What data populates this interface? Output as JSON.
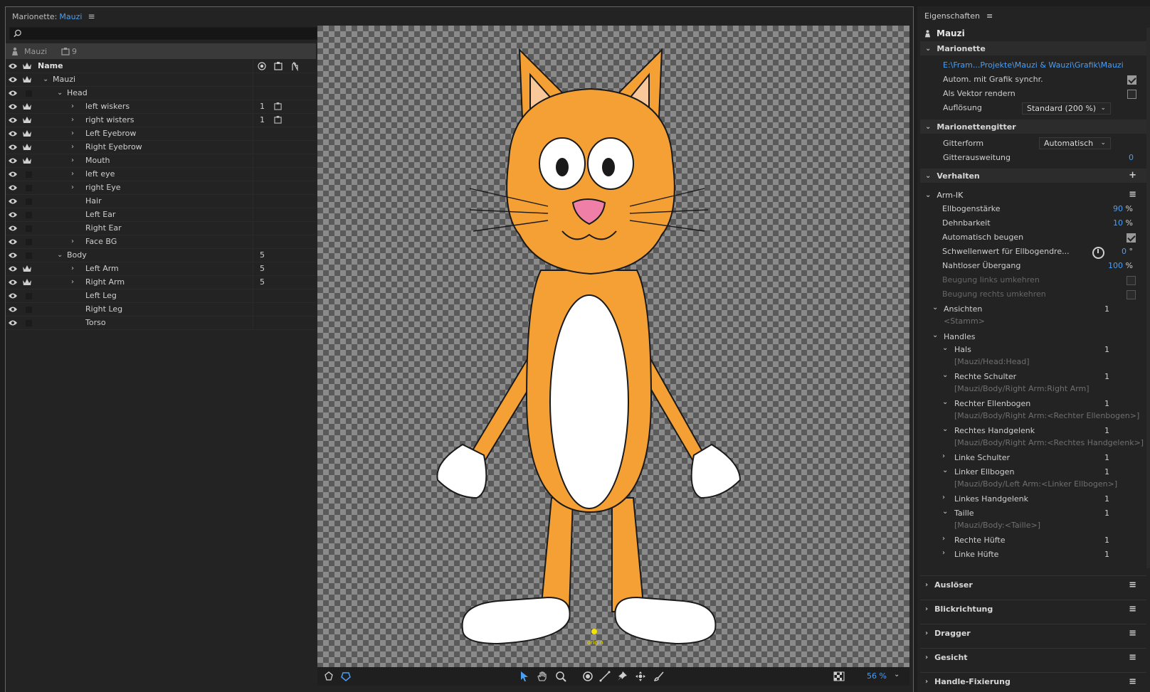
{
  "header": {
    "prefix": "Marionette:",
    "puppet_name": "Mauzi"
  },
  "puppet_bar": {
    "name": "Mauzi",
    "count": "9"
  },
  "layer_header": {
    "name": "Name"
  },
  "layers": [
    {
      "name": "Mauzi",
      "indent": 0,
      "expanded": true,
      "crown": true,
      "num": "",
      "icon": false,
      "has_chev": true
    },
    {
      "name": "Head",
      "indent": 1,
      "expanded": true,
      "crown": false,
      "num": "",
      "icon": false,
      "has_chev": true
    },
    {
      "name": "left wiskers",
      "indent": 2,
      "expanded": false,
      "crown": true,
      "num": "1",
      "icon": true,
      "has_chev": true
    },
    {
      "name": "right wisters",
      "indent": 2,
      "expanded": false,
      "crown": true,
      "num": "1",
      "icon": true,
      "has_chev": true
    },
    {
      "name": "Left Eyebrow",
      "indent": 2,
      "expanded": false,
      "crown": true,
      "num": "",
      "icon": false,
      "has_chev": true
    },
    {
      "name": "Right Eyebrow",
      "indent": 2,
      "expanded": false,
      "crown": true,
      "num": "",
      "icon": false,
      "has_chev": true
    },
    {
      "name": "Mouth",
      "indent": 2,
      "expanded": false,
      "crown": true,
      "num": "",
      "icon": false,
      "has_chev": true
    },
    {
      "name": "left eye",
      "indent": 2,
      "expanded": false,
      "crown": false,
      "num": "",
      "icon": false,
      "has_chev": true
    },
    {
      "name": "right Eye",
      "indent": 2,
      "expanded": false,
      "crown": false,
      "num": "",
      "icon": false,
      "has_chev": true
    },
    {
      "name": "Hair",
      "indent": 2,
      "expanded": false,
      "crown": false,
      "num": "",
      "icon": false,
      "has_chev": false
    },
    {
      "name": "Left Ear",
      "indent": 2,
      "expanded": false,
      "crown": false,
      "num": "",
      "icon": false,
      "has_chev": false
    },
    {
      "name": "Right Ear",
      "indent": 2,
      "expanded": false,
      "crown": false,
      "num": "",
      "icon": false,
      "has_chev": false
    },
    {
      "name": "Face BG",
      "indent": 2,
      "expanded": false,
      "crown": false,
      "num": "",
      "icon": false,
      "has_chev": true
    },
    {
      "name": "Body",
      "indent": 1,
      "expanded": true,
      "crown": false,
      "num": "5",
      "icon": false,
      "has_chev": true
    },
    {
      "name": "Left Arm",
      "indent": 2,
      "expanded": false,
      "crown": true,
      "num": "5",
      "icon": false,
      "has_chev": true
    },
    {
      "name": "Right Arm",
      "indent": 2,
      "expanded": false,
      "crown": true,
      "num": "5",
      "icon": false,
      "has_chev": true
    },
    {
      "name": "Left Leg",
      "indent": 2,
      "expanded": false,
      "crown": false,
      "num": "",
      "icon": false,
      "has_chev": false
    },
    {
      "name": "Right Leg",
      "indent": 2,
      "expanded": false,
      "crown": false,
      "num": "",
      "icon": false,
      "has_chev": false
    },
    {
      "name": "Torso",
      "indent": 2,
      "expanded": false,
      "crown": false,
      "num": "",
      "icon": false,
      "has_chev": false
    }
  ],
  "canvas": {
    "origin_label": "origin",
    "zoom": "56 %"
  },
  "properties": {
    "title": "Eigenschaften",
    "puppet": "Mauzi",
    "marionette": {
      "label": "Marionette",
      "path": "E:\\Fram...Projekte\\Mauzi & Wauzi\\Grafik\\Mauzi",
      "sync_label": "Autom. mit Grafik synchr.",
      "vector_label": "Als Vektor rendern",
      "resolution_label": "Auflösung",
      "resolution_value": "Standard (200 %)"
    },
    "mesh": {
      "label": "Marionettengitter",
      "form_label": "Gitterform",
      "form_value": "Automatisch",
      "expand_label": "Gitterausweitung",
      "expand_value": "0"
    },
    "behaviors": {
      "label": "Verhalten",
      "armik": "Arm-IK",
      "elbow_label": "Ellbogenstärke",
      "elbow_value": "90",
      "stretch_label": "Dehnbarkeit",
      "stretch_value": "10",
      "autobend_label": "Automatisch beugen",
      "threshold_label": "Schwellenwert für Ellbogendre...",
      "threshold_value": "0",
      "seamless_label": "Nahtloser Übergang",
      "seamless_value": "100",
      "flip_left_label": "Beugung links umkehren",
      "flip_right_label": "Beugung rechts umkehren",
      "views_label": "Ansichten",
      "views_value": "<Stamm>",
      "views_count": "1",
      "handles_label": "Handles",
      "handles": [
        {
          "name": "Hals",
          "path": "[Mauzi/Head:Head]",
          "count": "1",
          "expanded": true
        },
        {
          "name": "Rechte Schulter",
          "path": "[Mauzi/Body/Right Arm:Right Arm]",
          "count": "1",
          "expanded": true
        },
        {
          "name": "Rechter Ellenbogen",
          "path": "[Mauzi/Body/Right Arm:<Rechter Ellenbogen>]",
          "count": "1",
          "expanded": true
        },
        {
          "name": "Rechtes Handgelenk",
          "path": "[Mauzi/Body/Right Arm:<Rechtes Handgelenk>]",
          "count": "1",
          "expanded": true
        },
        {
          "name": "Linke Schulter",
          "path": "",
          "count": "1",
          "expanded": false
        },
        {
          "name": "Linker Ellbogen",
          "path": "[Mauzi/Body/Left Arm:<Linker Ellbogen>]",
          "count": "1",
          "expanded": true
        },
        {
          "name": "Linkes Handgelenk",
          "path": "",
          "count": "1",
          "expanded": false
        },
        {
          "name": "Taille",
          "path": "[Mauzi/Body:<Taille>]",
          "count": "1",
          "expanded": true
        },
        {
          "name": "Rechte Hüfte",
          "path": "",
          "count": "1",
          "expanded": false
        },
        {
          "name": "Linke Hüfte",
          "path": "",
          "count": "1",
          "expanded": false
        }
      ]
    },
    "more_sections": [
      "Auslöser",
      "Blickrichtung",
      "Dragger",
      "Gesicht",
      "Handle-Fixierung"
    ]
  },
  "colors": {
    "accent": "#4a9ff5",
    "fur": "#f4a035",
    "nose": "#ef7fa6"
  },
  "units": {
    "percent": "%",
    "degree": "°"
  }
}
